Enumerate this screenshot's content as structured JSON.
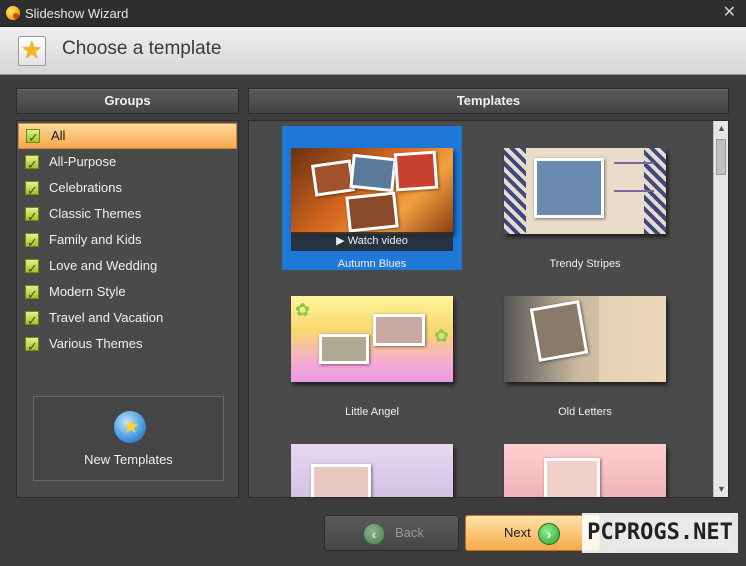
{
  "window": {
    "title": "Slideshow Wizard",
    "close_glyph": "✕"
  },
  "header": {
    "title": "Choose a template",
    "icon": "star-icon"
  },
  "groups": {
    "heading": "Groups",
    "items": [
      {
        "label": "All",
        "selected": true
      },
      {
        "label": "All-Purpose"
      },
      {
        "label": "Celebrations"
      },
      {
        "label": "Classic Themes"
      },
      {
        "label": "Family and Kids"
      },
      {
        "label": "Love and Wedding"
      },
      {
        "label": "Modern Style"
      },
      {
        "label": "Travel and Vacation"
      },
      {
        "label": "Various Themes"
      }
    ],
    "new_templates": "New Templates"
  },
  "templates": {
    "heading": "Templates",
    "watch_video": "▶  Watch video",
    "items": [
      {
        "name": "Autumn Blues",
        "selected": true
      },
      {
        "name": "Trendy Stripes"
      },
      {
        "name": "Little Angel"
      },
      {
        "name": "Old Letters"
      }
    ]
  },
  "scroll": {
    "up": "▲",
    "down": "▼"
  },
  "footer": {
    "back": "Back",
    "next": "Next",
    "back_glyph": "‹",
    "next_glyph": "›"
  },
  "watermark": "PCPROGS.NET",
  "colors": {
    "selection_blue": "#1e78d8",
    "selected_group_orange": "#f7a64c",
    "next_button": "#f7a94a"
  }
}
